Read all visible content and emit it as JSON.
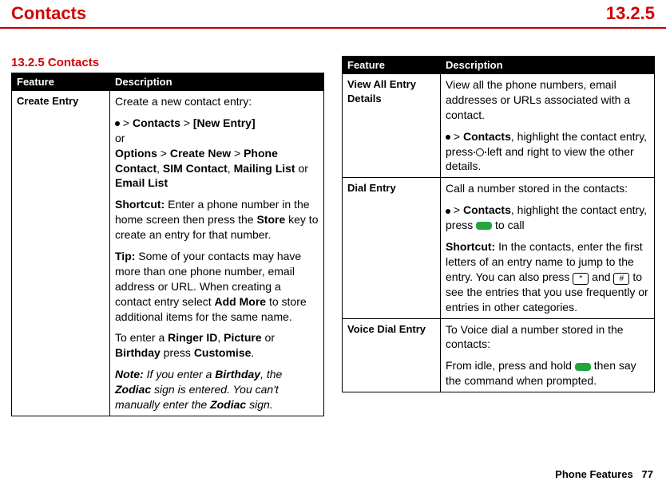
{
  "header": {
    "title": "Contacts",
    "version": "13.2.5"
  },
  "section_title": "13.2.5 Contacts",
  "table_headers": {
    "feature": "Feature",
    "description": "Description"
  },
  "left": {
    "feature": "Create Entry",
    "intro": "Create a new contact entry:",
    "path1_contacts": "Contacts",
    "path1_new": "[New Entry]",
    "or": "or",
    "options": "Options",
    "create_new": "Create New",
    "phone_contact": "Phone Contact",
    "sim_contact": "SIM Contact",
    "mailing_list": "Mailing List",
    "email_list": "Email List",
    "shortcut_label": "Shortcut:",
    "shortcut_a": " Enter a phone number in the home screen then press the ",
    "store": "Store",
    "shortcut_b": " key to create an entry for that number.",
    "tip_label": "Tip:",
    "tip_a": " Some of your contacts may have more than one phone number, email address or URL. When creating a contact entry select ",
    "addmore": "Add More",
    "tip_b": " to store additional items for the same name.",
    "enter_a": "To enter a ",
    "ringer": "Ringer ID",
    "picture": "Picture",
    "birthday": "Birthday",
    "enter_b": " press ",
    "customise": "Customise",
    "note_label": "Note:",
    "note_a": " If you enter a ",
    "note_b": ", the ",
    "zodiac": "Zodiac",
    "note_c": " sign is entered. You can't manually enter the ",
    "note_d": " sign."
  },
  "right": {
    "r1_feature": "View All Entry Details",
    "r1_a": "View all the phone numbers, email addresses or URLs associated with a contact.",
    "r1_b_contacts": "Contacts",
    "r1_b2": ", highlight the contact entry, press ",
    "r1_b3": " left and right to view the other details.",
    "r2_feature": "Dial Entry",
    "r2_a": "Call a number stored in the contacts:",
    "r2_b_contacts": "Contacts",
    "r2_b2": ", highlight the contact entry, press ",
    "r2_b3": " to call",
    "r2_short_label": "Shortcut:",
    "r2_short_a": " In the contacts, enter the first letters of an entry name to jump to the entry. You can also press ",
    "r2_short_b": " and ",
    "r2_short_c": " to see the entries that you use frequently or entries in other categories.",
    "star": "*",
    "hash": "#",
    "r3_feature": "Voice Dial Entry",
    "r3_a": "To Voice dial a number stored in the contacts:",
    "r3_b1": "From idle, press and hold ",
    "r3_b2": " then say the command when prompted."
  },
  "footer": {
    "section": "Phone Features",
    "page": "77"
  }
}
